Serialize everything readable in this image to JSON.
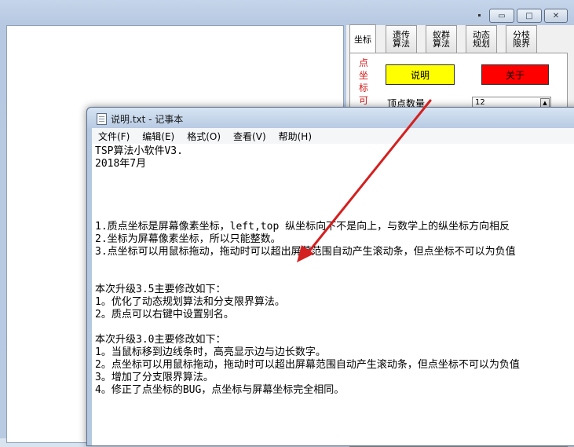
{
  "background_app": {
    "window_controls": {
      "minimize": "▭",
      "maximize": "□",
      "close": "✕"
    },
    "tabs": [
      {
        "label": "坐标"
      },
      {
        "label": "遗传\n算法"
      },
      {
        "label": "蚁群\n算法"
      },
      {
        "label": "动态\n规划"
      },
      {
        "label": "分枝\n限界"
      }
    ],
    "vertical_text": "点坐标可以",
    "explain_button": "说明",
    "about_button": "关于",
    "vertex_count_label": "顶点数量",
    "vertex_count_value": "12",
    "colors": {
      "explain_button": "#ffff00",
      "about_button": "#ff0000",
      "vertical_text": "#d41a1a"
    }
  },
  "notepad": {
    "title": "说明.txt - 记事本",
    "menu": [
      "文件(F)",
      "编辑(E)",
      "格式(O)",
      "查看(V)",
      "帮助(H)"
    ],
    "lines": [
      "TSP算法小软件V3.",
      "2018年7月",
      "",
      "",
      "",
      "",
      "1.质点坐标是屏幕像素坐标，left,top 纵坐标向下不是向上，与数学上的纵坐标方向相反",
      "2.坐标为屏幕像素坐标，所以只能整数。",
      "3.点坐标可以用鼠标拖动，拖动时可以超出屏幕范围自动产生滚动条，但点坐标不可以为负值",
      "",
      "",
      "本次升级3.5主要修改如下：",
      "1。优化了动态规划算法和分支限界算法。",
      "2。质点可以右键中设置别名。",
      "",
      "本次升级3.0主要修改如下：",
      "1。当鼠标移到边线条时，高亮显示边与边长数字。",
      "2。点坐标可以用鼠标拖动，拖动时可以超出屏幕范围自动产生滚动条，但点坐标不可以为负值",
      "3。增加了分支限界算法。",
      "4。修正了点坐标的BUG，点坐标与屏幕坐标完全相同。"
    ]
  },
  "annotation": {
    "arrow_color": "#d42020"
  }
}
